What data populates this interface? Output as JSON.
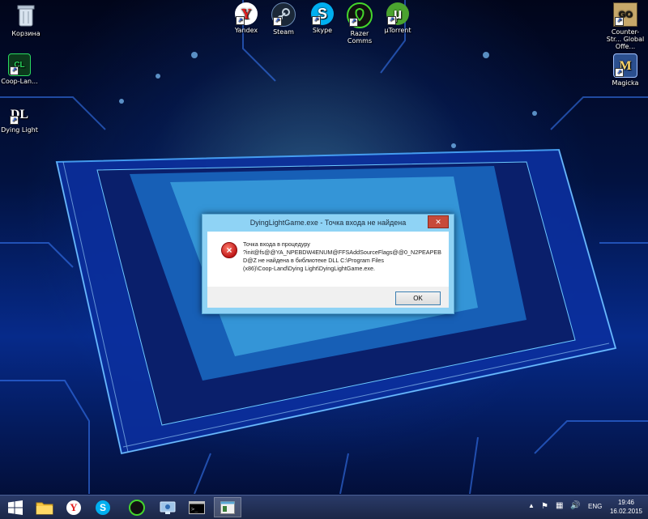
{
  "desktop": {
    "icons_left": [
      {
        "label": "Корзина",
        "icon": "recycle-bin-icon"
      },
      {
        "label": "Coop-Lan...",
        "icon": "coop-land-icon"
      },
      {
        "label": "Dying Light",
        "icon": "dying-light-icon"
      }
    ],
    "icons_top": [
      {
        "label": "Yandex",
        "icon": "yandex-icon"
      },
      {
        "label": "Steam",
        "icon": "steam-icon"
      },
      {
        "label": "Skype",
        "icon": "skype-icon"
      },
      {
        "label": "Razer Comms",
        "icon": "razer-comms-icon"
      },
      {
        "label": "µTorrent",
        "icon": "utorrent-icon"
      }
    ],
    "icons_right": [
      {
        "label": "Counter-Str... Global Offe...",
        "icon": "csgo-icon"
      },
      {
        "label": "Magicka",
        "icon": "magicka-icon"
      }
    ]
  },
  "dialog": {
    "title": "DyingLightGame.exe - Точка входа не найдена",
    "close_glyph": "✕",
    "message_lines": [
      "Точка входа в процедуру",
      "?init@fs@@YA_NPEBDW4ENUM@FFSAddSourceFlags@@0_N2PEAPEB",
      "D@Z не найдена в библиотеке DLL C:\\Program Files",
      "(x86)\\Coop-Land\\Dying Light\\DyingLightGame.exe."
    ],
    "ok_label": "OK",
    "icon": "error-icon"
  },
  "taskbar": {
    "items": [
      {
        "name": "start-button",
        "icon": "windows-logo-icon"
      },
      {
        "name": "file-explorer",
        "icon": "folder-icon"
      },
      {
        "name": "yandex",
        "icon": "yandex-icon"
      },
      {
        "name": "skype",
        "icon": "skype-icon"
      },
      {
        "name": "razer-comms",
        "icon": "razer-comms-icon"
      },
      {
        "name": "network-tool",
        "icon": "network-icon"
      },
      {
        "name": "command-prompt",
        "icon": "cmd-icon"
      },
      {
        "name": "dying-light-app",
        "icon": "dying-light-window-icon"
      }
    ],
    "tray": {
      "language": "ENG",
      "time": "19:46",
      "date": "16.02.2015"
    }
  },
  "colors": {
    "taskbar": "#1f2c52",
    "dialog_frame": "#8fd3f5",
    "error_red": "#c01818"
  }
}
